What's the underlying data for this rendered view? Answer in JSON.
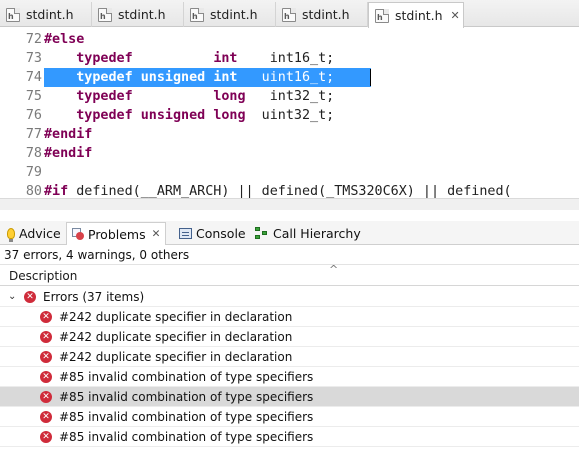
{
  "editor_tabs": [
    {
      "icon": "header-file-icon",
      "icon_text": "h",
      "label": "stdint.h"
    },
    {
      "icon": "header-file-icon",
      "icon_text": "h",
      "label": "stdint.h"
    },
    {
      "icon": "header-file-icon",
      "icon_text": "h",
      "label": "stdint.h"
    },
    {
      "icon": "header-file-icon",
      "icon_text": "h",
      "label": "stdint.h"
    },
    {
      "icon": "header-file-icon",
      "icon_text": "h",
      "label": "stdint.h",
      "active": true,
      "close": "✕"
    }
  ],
  "code": {
    "lines": [
      {
        "n": "72",
        "parts": [
          {
            "t": "#else",
            "k": "pp"
          }
        ]
      },
      {
        "n": "73",
        "parts": [
          {
            "t": "    "
          },
          {
            "t": "typedef",
            "k": "kw"
          },
          {
            "t": "          "
          },
          {
            "t": "int",
            "k": "kw"
          },
          {
            "t": "    int16_t;"
          }
        ]
      },
      {
        "n": "74",
        "selected": true,
        "parts": [
          {
            "t": "    "
          },
          {
            "t": "typedef",
            "k": "kw"
          },
          {
            "t": " "
          },
          {
            "t": "unsigned",
            "k": "kw"
          },
          {
            "t": " "
          },
          {
            "t": "int",
            "k": "kw"
          },
          {
            "t": "   uint16_t;"
          }
        ]
      },
      {
        "n": "75",
        "parts": [
          {
            "t": "    "
          },
          {
            "t": "typedef",
            "k": "kw"
          },
          {
            "t": "          "
          },
          {
            "t": "long",
            "k": "kw"
          },
          {
            "t": "   int32_t;"
          }
        ]
      },
      {
        "n": "76",
        "parts": [
          {
            "t": "    "
          },
          {
            "t": "typedef",
            "k": "kw"
          },
          {
            "t": " "
          },
          {
            "t": "unsigned",
            "k": "kw"
          },
          {
            "t": " "
          },
          {
            "t": "long",
            "k": "kw"
          },
          {
            "t": "  uint32_t;"
          }
        ]
      },
      {
        "n": "77",
        "parts": [
          {
            "t": "#endif",
            "k": "pp"
          }
        ]
      },
      {
        "n": "78",
        "parts": [
          {
            "t": "#endif",
            "k": "pp"
          }
        ]
      },
      {
        "n": "79",
        "parts": []
      },
      {
        "n": "80",
        "parts": [
          {
            "t": "#if",
            "k": "pp"
          },
          {
            "t": " defined(__ARM_ARCH) || defined(_TMS320C6X) || defined("
          }
        ]
      }
    ]
  },
  "panel_tabs": [
    {
      "icon": "lightbulb-icon",
      "label": "Advice"
    },
    {
      "icon": "problems-icon",
      "label": "Problems",
      "active": true,
      "close": "✕"
    },
    {
      "icon": "console-icon",
      "label": "Console"
    },
    {
      "icon": "call-hierarchy-icon",
      "label": "Call Hierarchy"
    }
  ],
  "problems": {
    "summary": "37 errors, 4 warnings, 0 others",
    "column_header": "Description",
    "sort_indicator": "^",
    "group": {
      "expander": "⌄",
      "label": "Errors (37 items)",
      "icon_glyph": "✕"
    },
    "items": [
      {
        "label": "#242 duplicate specifier in declaration"
      },
      {
        "label": "#242 duplicate specifier in declaration"
      },
      {
        "label": "#242 duplicate specifier in declaration"
      },
      {
        "label": "#85 invalid combination of type specifiers"
      },
      {
        "label": "#85 invalid combination of type specifiers",
        "selected": true
      },
      {
        "label": "#85 invalid combination of type specifiers"
      },
      {
        "label": "#85 invalid combination of type specifiers"
      }
    ]
  },
  "colors": {
    "keyword": "#7f0055",
    "selection": "#3399ff",
    "error_icon": "#cf2b3a",
    "selected_row": "#d9d9d9"
  }
}
